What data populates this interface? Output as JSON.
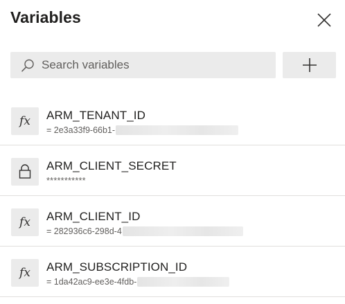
{
  "panel": {
    "title": "Variables",
    "close_icon": "close-icon"
  },
  "search": {
    "placeholder": "Search variables",
    "value": "",
    "icon": "search-icon"
  },
  "add_button": {
    "icon": "plus-icon"
  },
  "variables": [
    {
      "name": "ARM_TENANT_ID",
      "value": "= 2e3a33f9-66b1-",
      "icon": "fx-icon",
      "redacted": true
    },
    {
      "name": "ARM_CLIENT_SECRET",
      "value": "***********",
      "icon": "lock-icon",
      "redacted": false
    },
    {
      "name": "ARM_CLIENT_ID",
      "value": "= 282936c6-298d-4",
      "icon": "fx-icon",
      "redacted": true
    },
    {
      "name": "ARM_SUBSCRIPTION_ID",
      "value": "= 1da42ac9-ee3e-4fdb-",
      "icon": "fx-icon",
      "redacted": true
    }
  ],
  "fx_glyph": "fx",
  "colors": {
    "background": "#ffffff",
    "control_bg": "#ebebeb",
    "text_primary": "#201f1e",
    "text_secondary": "#605e5c",
    "divider": "#e1dfdd"
  }
}
